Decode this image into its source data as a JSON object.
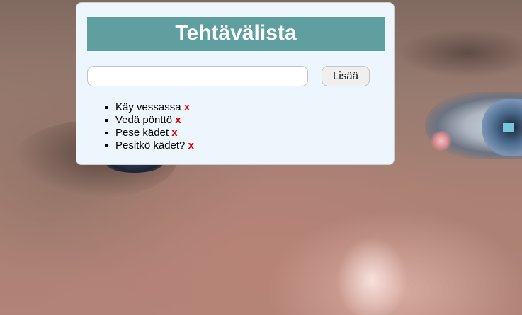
{
  "app": {
    "title": "Tehtävälista"
  },
  "form": {
    "input_value": "",
    "input_placeholder": "",
    "add_label": "Lisää"
  },
  "tasks": [
    {
      "text": "Käy vessassa",
      "remove_label": "x"
    },
    {
      "text": "Vedä pönttö",
      "remove_label": "x"
    },
    {
      "text": "Pese kädet",
      "remove_label": "x"
    },
    {
      "text": "Pesitkö kädet?",
      "remove_label": "x"
    }
  ],
  "colors": {
    "title_background": "#5f9f9f",
    "card_background": "#eef6fd",
    "remove_color": "#e00000"
  }
}
